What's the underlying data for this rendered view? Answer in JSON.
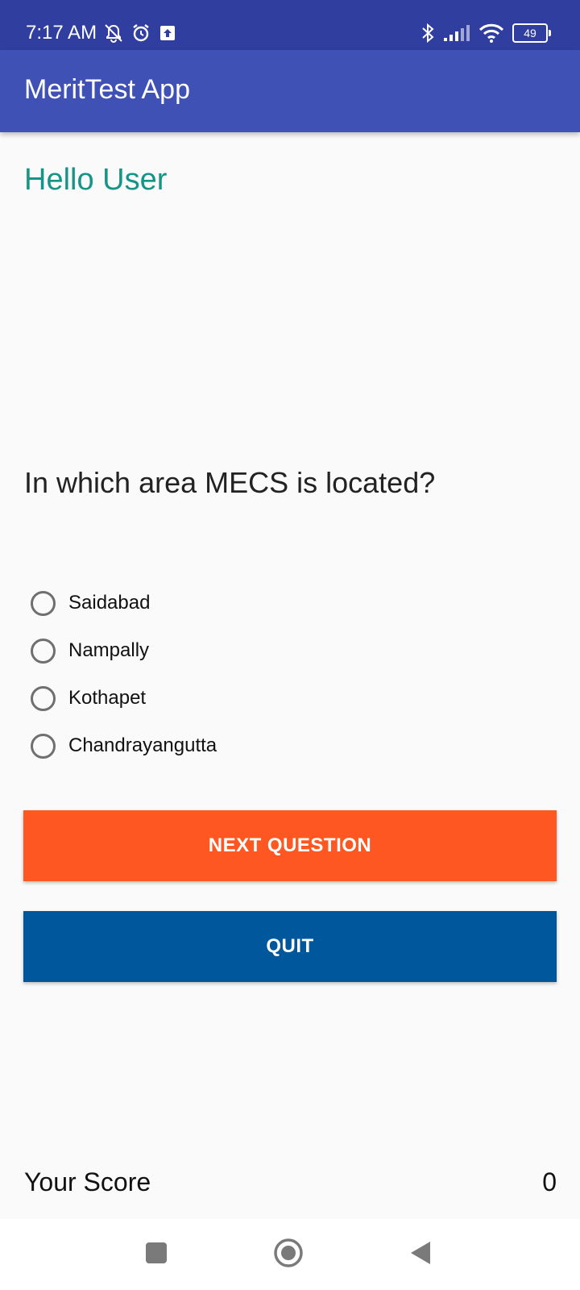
{
  "status_bar": {
    "time": "7:17 AM",
    "battery_level": "49",
    "icons": [
      "mute-notification-icon",
      "alarm-icon",
      "upload-icon",
      "bluetooth-icon",
      "signal-icon",
      "wifi-icon",
      "battery-icon"
    ]
  },
  "app_bar": {
    "title": "MeritTest App",
    "color": "#3f51b5"
  },
  "greeting": "Hello User",
  "question": "In which area MECS is located?",
  "options": [
    "Saidabad",
    "Nampally",
    "Kothapet",
    "Chandrayangutta"
  ],
  "buttons": {
    "next_label": "NEXT QUESTION",
    "next_color": "#ff5722",
    "quit_label": "QUIT",
    "quit_color": "#01579b"
  },
  "score": {
    "label": "Your Score",
    "value": "0"
  },
  "nav_bar": {
    "icons": [
      "recents-icon",
      "home-icon",
      "back-icon"
    ]
  }
}
